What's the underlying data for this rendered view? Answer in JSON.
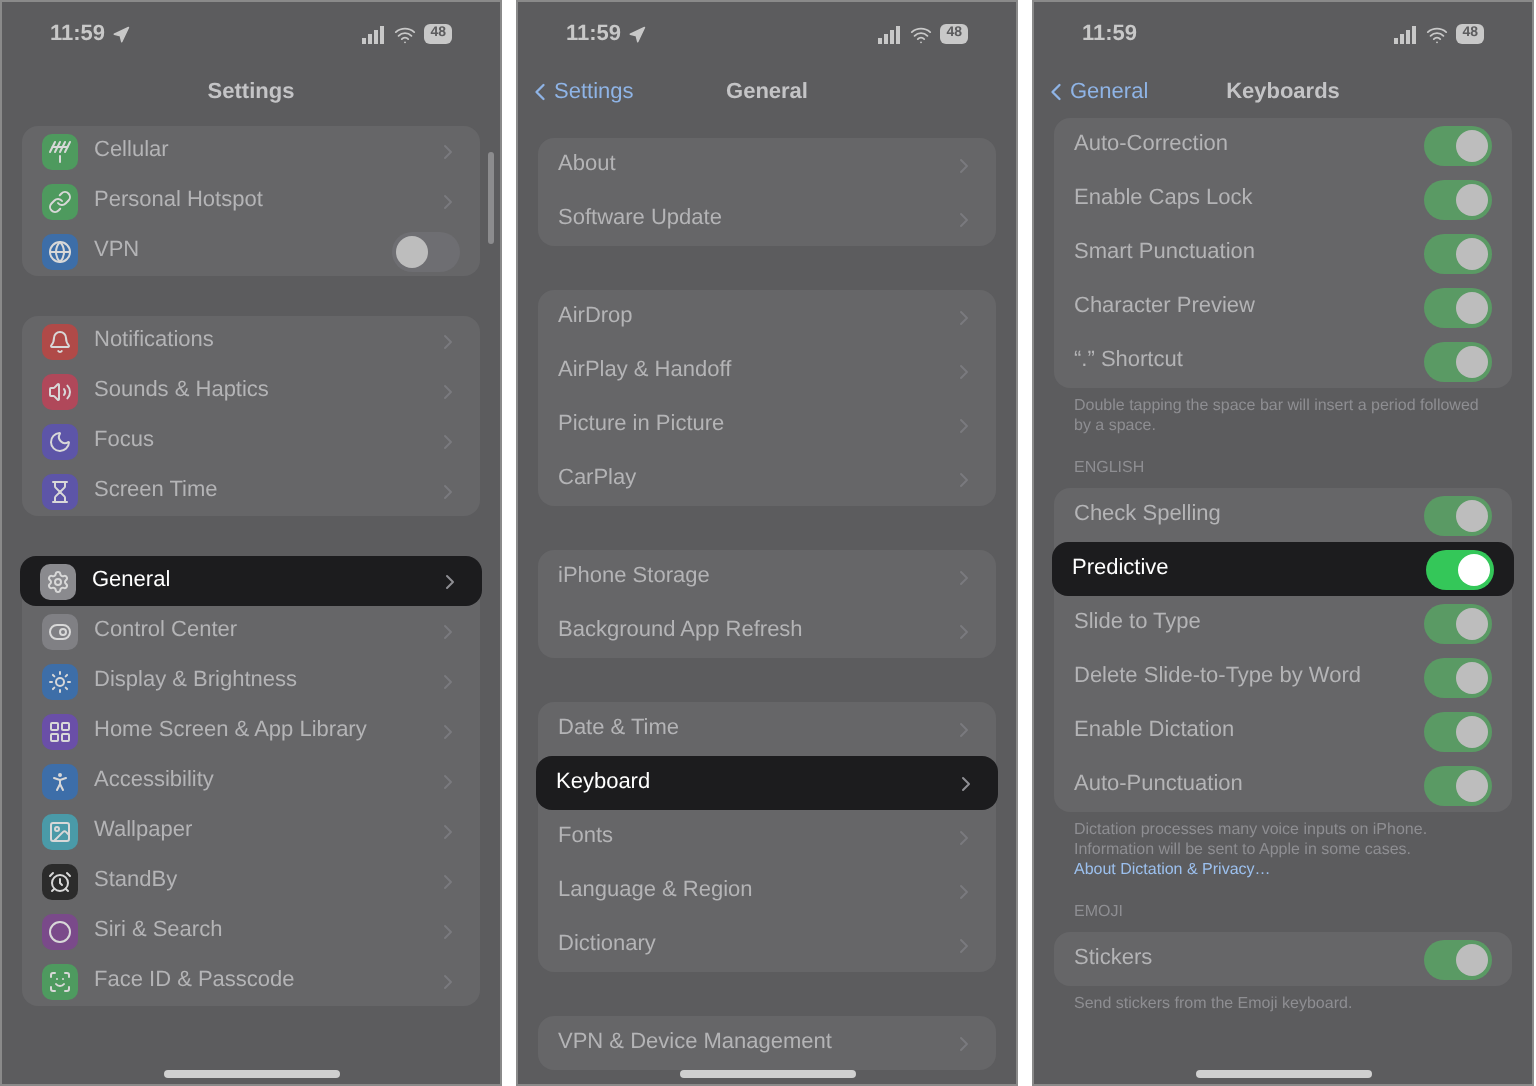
{
  "phones": [
    {
      "status": {
        "time": "11:59",
        "location": true,
        "battery": "48"
      },
      "nav": {
        "title": "Settings"
      },
      "scroll_indicator": true,
      "sections": [
        {
          "rows": [
            {
              "label": "Cellular",
              "color": "#4e9a5e",
              "kind": "link",
              "selected": false
            },
            {
              "label": "Personal Hotspot",
              "color": "#4e9a5e",
              "kind": "link",
              "selected": false
            },
            {
              "label": "VPN",
              "color": "#3d6ea8",
              "kind": "toggle",
              "on": false,
              "selected": false
            }
          ]
        },
        {
          "rows": [
            {
              "label": "Notifications",
              "color": "#b04a48",
              "kind": "link",
              "selected": false
            },
            {
              "label": "Sounds & Haptics",
              "color": "#b0485a",
              "kind": "link",
              "selected": false
            },
            {
              "label": "Focus",
              "color": "#5d55a8",
              "kind": "link",
              "selected": false
            },
            {
              "label": "Screen Time",
              "color": "#5d55a8",
              "kind": "link",
              "selected": false
            }
          ]
        },
        {
          "rows": [
            {
              "label": "General",
              "color": "#8a8a8e",
              "kind": "link",
              "selected": true
            },
            {
              "label": "Control Center",
              "color": "#808084",
              "kind": "link",
              "selected": false
            },
            {
              "label": "Display & Brightness",
              "color": "#3d6ea8",
              "kind": "link",
              "selected": false
            },
            {
              "label": "Home Screen & App Library",
              "color": "#6a4fa8",
              "kind": "link",
              "selected": false
            },
            {
              "label": "Accessibility",
              "color": "#3d6ea9",
              "kind": "link",
              "selected": false
            },
            {
              "label": "Wallpaper",
              "color": "#4a9aa8",
              "kind": "link",
              "selected": false
            },
            {
              "label": "StandBy",
              "color": "#2b2b2b",
              "kind": "link",
              "selected": false
            },
            {
              "label": "Siri & Search",
              "color": "#7a4a8a",
              "kind": "link",
              "selected": false
            },
            {
              "label": "Face ID & Passcode",
              "color": "#4e9a5f",
              "kind": "link",
              "selected": false
            }
          ]
        }
      ]
    },
    {
      "status": {
        "time": "11:59",
        "location": true,
        "battery": "48"
      },
      "nav": {
        "back": "Settings",
        "title": "General"
      },
      "scroll_indicator": false,
      "sections": [
        {
          "rows": [
            {
              "label": "About",
              "kind": "link",
              "selected": false
            },
            {
              "label": "Software Update",
              "kind": "link",
              "selected": false
            }
          ]
        },
        {
          "rows": [
            {
              "label": "AirDrop",
              "kind": "link",
              "selected": false
            },
            {
              "label": "AirPlay & Handoff",
              "kind": "link",
              "selected": false
            },
            {
              "label": "Picture in Picture",
              "kind": "link",
              "selected": false
            },
            {
              "label": "CarPlay",
              "kind": "link",
              "selected": false
            }
          ]
        },
        {
          "rows": [
            {
              "label": "iPhone Storage",
              "kind": "link",
              "selected": false
            },
            {
              "label": "Background App Refresh",
              "kind": "link",
              "selected": false
            }
          ]
        },
        {
          "rows": [
            {
              "label": "Date & Time",
              "kind": "link",
              "selected": false
            },
            {
              "label": "Keyboard",
              "kind": "link",
              "selected": true
            },
            {
              "label": "Fonts",
              "kind": "link",
              "selected": false
            },
            {
              "label": "Language & Region",
              "kind": "link",
              "selected": false
            },
            {
              "label": "Dictionary",
              "kind": "link",
              "selected": false
            }
          ]
        },
        {
          "rows": [
            {
              "label": "VPN & Device Management",
              "kind": "link",
              "selected": false
            }
          ]
        }
      ]
    },
    {
      "status": {
        "time": "11:59",
        "location": false,
        "battery": "48"
      },
      "nav": {
        "back": "General",
        "title": "Keyboards"
      },
      "scroll_indicator": false,
      "sections": [
        {
          "rows": [
            {
              "label": "Auto-Correction",
              "kind": "toggle",
              "on": true,
              "selected": false
            },
            {
              "label": "Enable Caps Lock",
              "kind": "toggle",
              "on": true,
              "selected": false
            },
            {
              "label": "Smart Punctuation",
              "kind": "toggle",
              "on": true,
              "selected": false
            },
            {
              "label": "Character Preview",
              "kind": "toggle",
              "on": true,
              "selected": false
            },
            {
              "label": "“.” Shortcut",
              "kind": "toggle",
              "on": true,
              "selected": false
            }
          ],
          "footer": "Double tapping the space bar will insert a period followed by a space."
        },
        {
          "header": "ENGLISH",
          "rows": [
            {
              "label": "Check Spelling",
              "kind": "toggle",
              "on": true,
              "selected": false
            },
            {
              "label": "Predictive",
              "kind": "toggle",
              "on": true,
              "selected": true
            },
            {
              "label": "Slide to Type",
              "kind": "toggle",
              "on": true,
              "selected": false
            },
            {
              "label": "Delete Slide-to-Type by Word",
              "kind": "toggle",
              "on": true,
              "selected": false
            },
            {
              "label": "Enable Dictation",
              "kind": "toggle",
              "on": true,
              "selected": false
            },
            {
              "label": "Auto-Punctuation",
              "kind": "toggle",
              "on": true,
              "selected": false
            }
          ],
          "footer": "Dictation processes many voice inputs on iPhone. Information will be sent to Apple in some cases.",
          "footer_link": "About Dictation & Privacy…"
        },
        {
          "header": "EMOJI",
          "rows": [
            {
              "label": "Stickers",
              "kind": "toggle",
              "on": true,
              "selected": false
            }
          ],
          "footer": "Send stickers from the Emoji keyboard."
        }
      ]
    }
  ]
}
